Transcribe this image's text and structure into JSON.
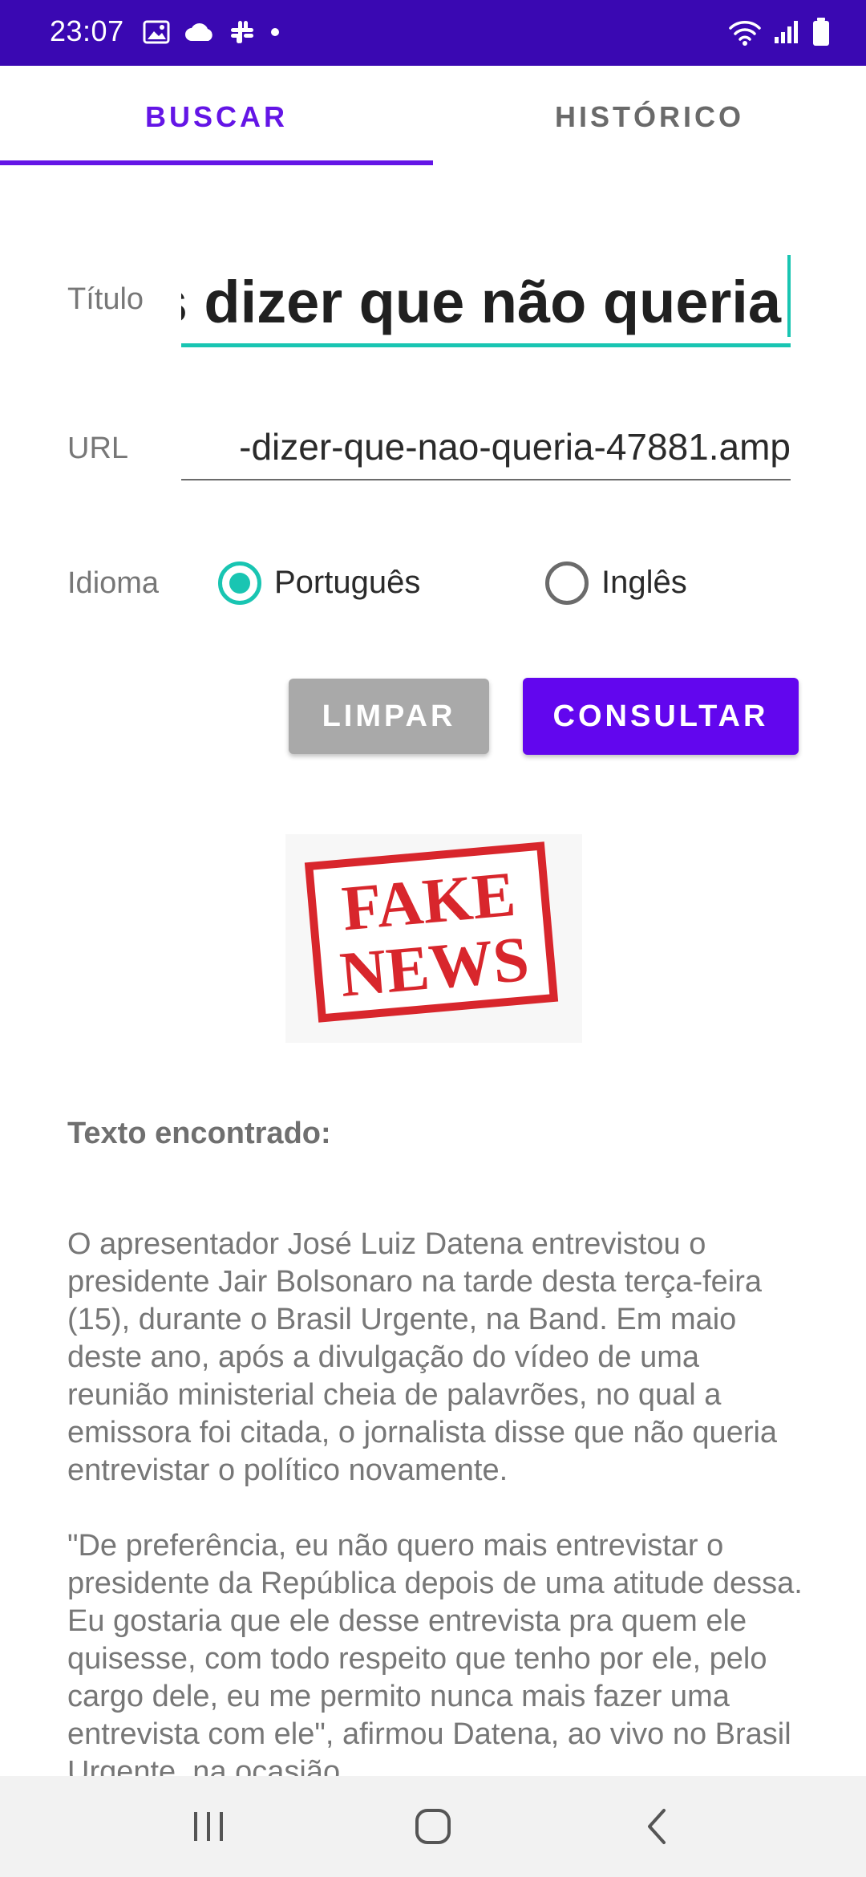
{
  "status_bar": {
    "time": "23:07",
    "left_icons": [
      "image-icon",
      "cloud-icon",
      "slack-icon",
      "dot-icon"
    ],
    "right_icons": [
      "wifi-icon",
      "signal-icon",
      "battery-icon"
    ],
    "background": "#3A08B2"
  },
  "tabs": [
    {
      "label": "BUSCAR",
      "active": true
    },
    {
      "label": "HISTÓRICO",
      "active": false
    }
  ],
  "form": {
    "title_label": "Título",
    "title_value": "s dizer que não queria",
    "url_label": "URL",
    "url_value": "-dizer-que-nao-queria-47881.amp",
    "language_label": "Idioma",
    "language_options": [
      {
        "label": "Português",
        "selected": true
      },
      {
        "label": "Inglês",
        "selected": false
      }
    ]
  },
  "buttons": {
    "clear_label": "LIMPAR",
    "consult_label": "CONSULTAR"
  },
  "result": {
    "stamp_line1": "FAKE",
    "stamp_line2": "NEWS",
    "heading": "Texto encontrado:",
    "text": "O apresentador José Luiz Datena entrevistou o presidente Jair Bolsonaro na tarde desta terça-feira (15), durante o Brasil Urgente, na Band. Em maio deste ano, após a divulgação do vídeo de uma reunião ministerial cheia de palavrões, no qual a emissora foi citada, o jornalista disse que não queria entrevistar o político novamente.\n\n\"De preferência, eu não quero mais entrevistar o presidente da República depois de uma atitude dessa. Eu gostaria que ele desse entrevista pra quem ele quisesse, com todo respeito que tenho por ele, pelo cargo dele, eu me permito nunca mais fazer uma entrevista com ele\", afirmou Datena, ao vivo no Brasil Urgente, na ocasião."
  },
  "nav_bar": {
    "buttons": [
      "recents-icon",
      "home-icon",
      "back-icon"
    ]
  },
  "colors": {
    "accent": "#6415E6",
    "teal": "#19C5B2",
    "stamp_red": "#D8262C"
  }
}
